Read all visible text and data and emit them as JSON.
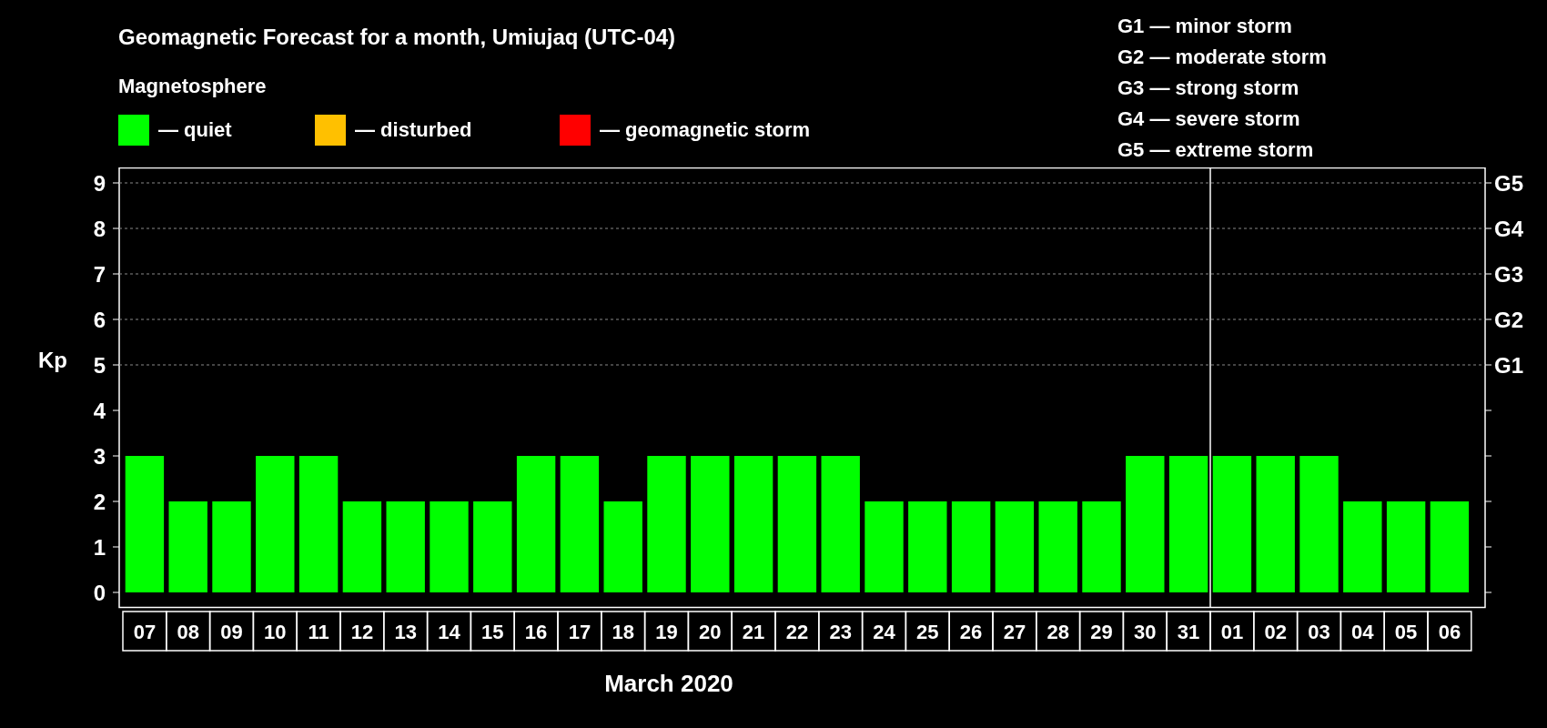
{
  "title": "Geomagnetic Forecast for a month, Umiujaq (UTC-04)",
  "legend": {
    "title": "Magnetosphere",
    "items": [
      {
        "label": "— quiet",
        "color": "#00ff00"
      },
      {
        "label": "— disturbed",
        "color": "#ffc000"
      },
      {
        "label": "— geomagnetic storm",
        "color": "#ff0000"
      }
    ]
  },
  "storm_scale": [
    "G1 — minor storm",
    "G2 — moderate storm",
    "G3 — strong storm",
    "G4 — severe storm",
    "G5 — extreme storm"
  ],
  "chart": {
    "chart_data": {
      "type": "bar",
      "xlabel": "March 2020",
      "ylabel": "Kp",
      "categories": [
        "07",
        "08",
        "09",
        "10",
        "11",
        "12",
        "13",
        "14",
        "15",
        "16",
        "17",
        "18",
        "19",
        "20",
        "21",
        "22",
        "23",
        "24",
        "25",
        "26",
        "27",
        "28",
        "29",
        "30",
        "31",
        "01",
        "02",
        "03",
        "04",
        "05",
        "06"
      ],
      "series": [
        {
          "color": "#00ff00",
          "values": [
            3,
            2,
            2,
            3,
            3,
            2,
            2,
            2,
            2,
            3,
            3,
            2,
            3,
            3,
            3,
            3,
            3,
            2,
            2,
            2,
            2,
            2,
            2,
            3,
            3,
            3,
            3,
            3,
            2,
            2,
            2
          ]
        }
      ],
      "ylim": [
        0,
        9
      ],
      "yticks": [
        0,
        1,
        2,
        3,
        4,
        5,
        6,
        7,
        8,
        9
      ],
      "grid": true,
      "ref_lines": [
        {
          "axis": "x",
          "value": "01",
          "color": "#ffffff"
        }
      ]
    },
    "right_axis": [
      "G5",
      "G4",
      "G3",
      "G2",
      "G1"
    ]
  }
}
